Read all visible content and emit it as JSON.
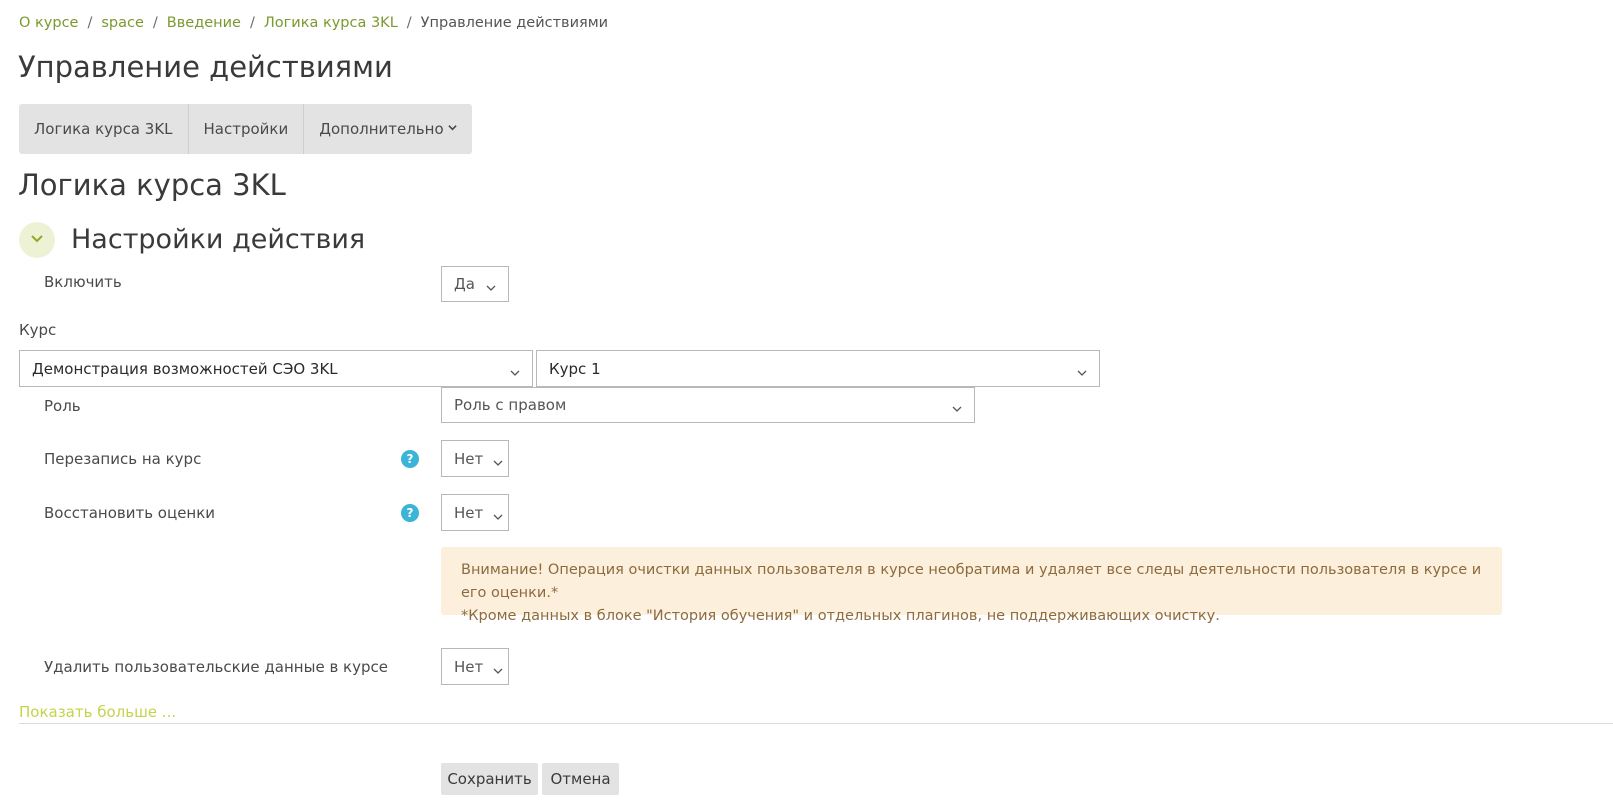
{
  "breadcrumb": {
    "items": [
      "О курсе",
      "space",
      "Введение",
      "Логика курса 3KL"
    ],
    "current": "Управление действиями",
    "separator": "/"
  },
  "page_title": "Управление действиями",
  "tabs": [
    {
      "label": "Логика курса 3KL"
    },
    {
      "label": "Настройки"
    },
    {
      "label": "Дополнительно"
    }
  ],
  "section_title": "Логика курса 3KL",
  "fieldset_title": "Настройки действия",
  "form": {
    "enable": {
      "label": "Включить",
      "value": "Да"
    },
    "course": {
      "label": "Курс",
      "category_value": "Демонстрация возможностей СЭО 3KL",
      "course_value": "Курс 1"
    },
    "role": {
      "label": "Роль",
      "value": "Роль с правом"
    },
    "reenroll": {
      "label": "Перезапись на курс",
      "value": "Нет"
    },
    "restore_grades": {
      "label": "Восстановить оценки",
      "value": "Нет"
    },
    "warning": {
      "line1": "Внимание! Операция очистки данных пользователя в курсе необратима и удаляет все следы деятельности пользователя в курсе и его оценки.*",
      "line2": "*Кроме данных в блоке \"История обучения\" и отдельных плагинов, не поддерживающих очистку."
    },
    "delete_user_data": {
      "label": "Удалить пользовательские данные в курсе",
      "value": "Нет"
    }
  },
  "show_more": "Показать больше ...",
  "buttons": {
    "save": "Сохранить",
    "cancel": "Отмена"
  },
  "colors": {
    "link": "#7a9a2e",
    "accent_light": "#eef2d5",
    "help": "#3bb4d8",
    "alert_bg": "#fcefdc",
    "alert_text": "#8e6b3e"
  },
  "icons": {
    "collapse": "chevron-down-icon",
    "help": "question-circle-icon"
  }
}
